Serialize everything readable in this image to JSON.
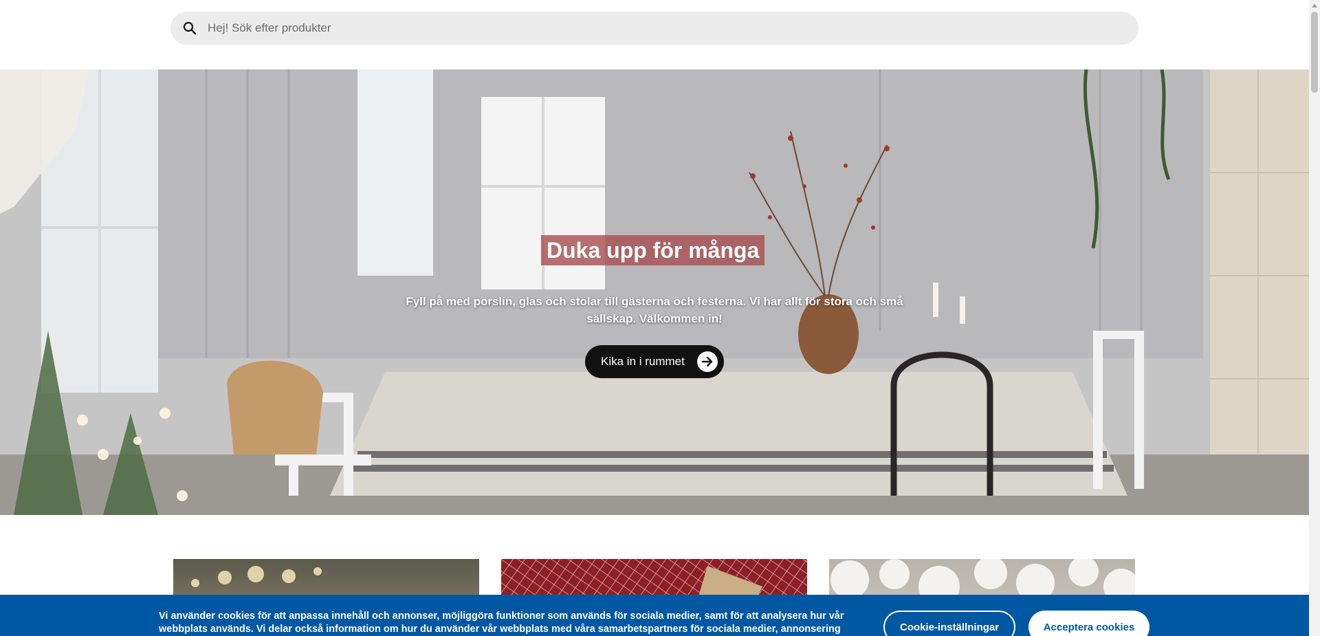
{
  "search": {
    "placeholder": "Hej! Sök efter produkter",
    "icon": "search-icon"
  },
  "hero": {
    "title": "Duka upp för många",
    "subtitle": "Fyll på med porslin, glas och stolar till gästerna och festerna. Vi har allt för stora och små sällskap. Välkommen in!",
    "button_label": "Kika in i rummet",
    "button_icon": "arrow-right-icon",
    "title_bg_color": "#aa5052"
  },
  "cards": [
    {
      "name": "card-christmas-lights"
    },
    {
      "name": "card-red-checked-textile"
    },
    {
      "name": "card-paper-lanterns"
    }
  ],
  "cookie_banner": {
    "text": "Vi använder cookies för att anpassa innehåll och annonser, möjliggöra funktioner som används för sociala medier, samt för att analysera hur vår webbplats används. Vi delar också information om hur du använder vår webbplats med våra samarbetspartners för sociala medier, annonsering och",
    "settings_label": "Cookie-inställningar",
    "accept_label": "Acceptera cookies",
    "background_color": "#0058a3"
  }
}
